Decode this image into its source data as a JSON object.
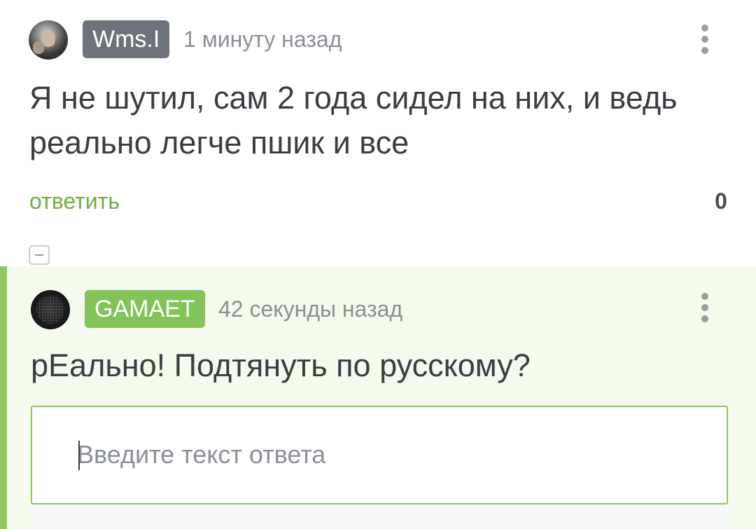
{
  "comments": [
    {
      "author": "Wms.I",
      "timestamp": "1 минуту назад",
      "text": "Я не шутил, сам 2 года сидел на них, и ведь реально легче пшик и все",
      "reply_label": "ответить",
      "rating": "0",
      "badge_color": "#6e737b"
    },
    {
      "author": "GAMAET",
      "timestamp": "42 секунды назад",
      "text": "рЕально! Подтянуть по русскому?",
      "badge_color": "#83c459"
    }
  ],
  "reply_form": {
    "placeholder": "Введите текст ответа",
    "value": ""
  },
  "icons": {
    "more": "more-vertical-icon",
    "collapse": "collapse-minus-icon"
  },
  "colors": {
    "accent_green": "#83c459",
    "thread_bg": "#f4faed",
    "reply_link": "#6fae3f"
  }
}
